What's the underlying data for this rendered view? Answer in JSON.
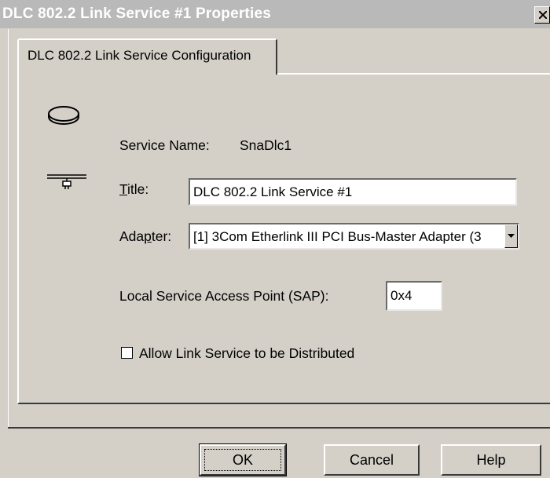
{
  "window": {
    "title": "DLC 802.2 Link Service #1 Properties",
    "close_glyph": "×"
  },
  "tabs": [
    {
      "label": "DLC 802.2 Link Service Configuration",
      "selected": true
    }
  ],
  "icons": [
    "ring-icon",
    "network-cable-icon"
  ],
  "form": {
    "service_name_label": "Service Name:",
    "service_name_value": "SnaDlc1",
    "title_label_accel": "T",
    "title_label_rest": "itle:",
    "title_value": "DLC 802.2 Link Service #1",
    "adapter_label_pre": "Ada",
    "adapter_label_accel": "p",
    "adapter_label_post": "ter:",
    "adapter_value": "[1] 3Com Etherlink III PCI Bus-Master Adapter (3",
    "sap_label": "Local Service Access Point (SAP):",
    "sap_value": "0x4",
    "distributed_label": "Allow Link Service to be Distributed",
    "distributed_checked": false
  },
  "buttons": {
    "ok": "OK",
    "cancel": "Cancel",
    "help": "Help"
  },
  "colors": {
    "face": "#d4d0c8",
    "titlebar": "#b9b9b9",
    "title_text": "#ffffff"
  }
}
